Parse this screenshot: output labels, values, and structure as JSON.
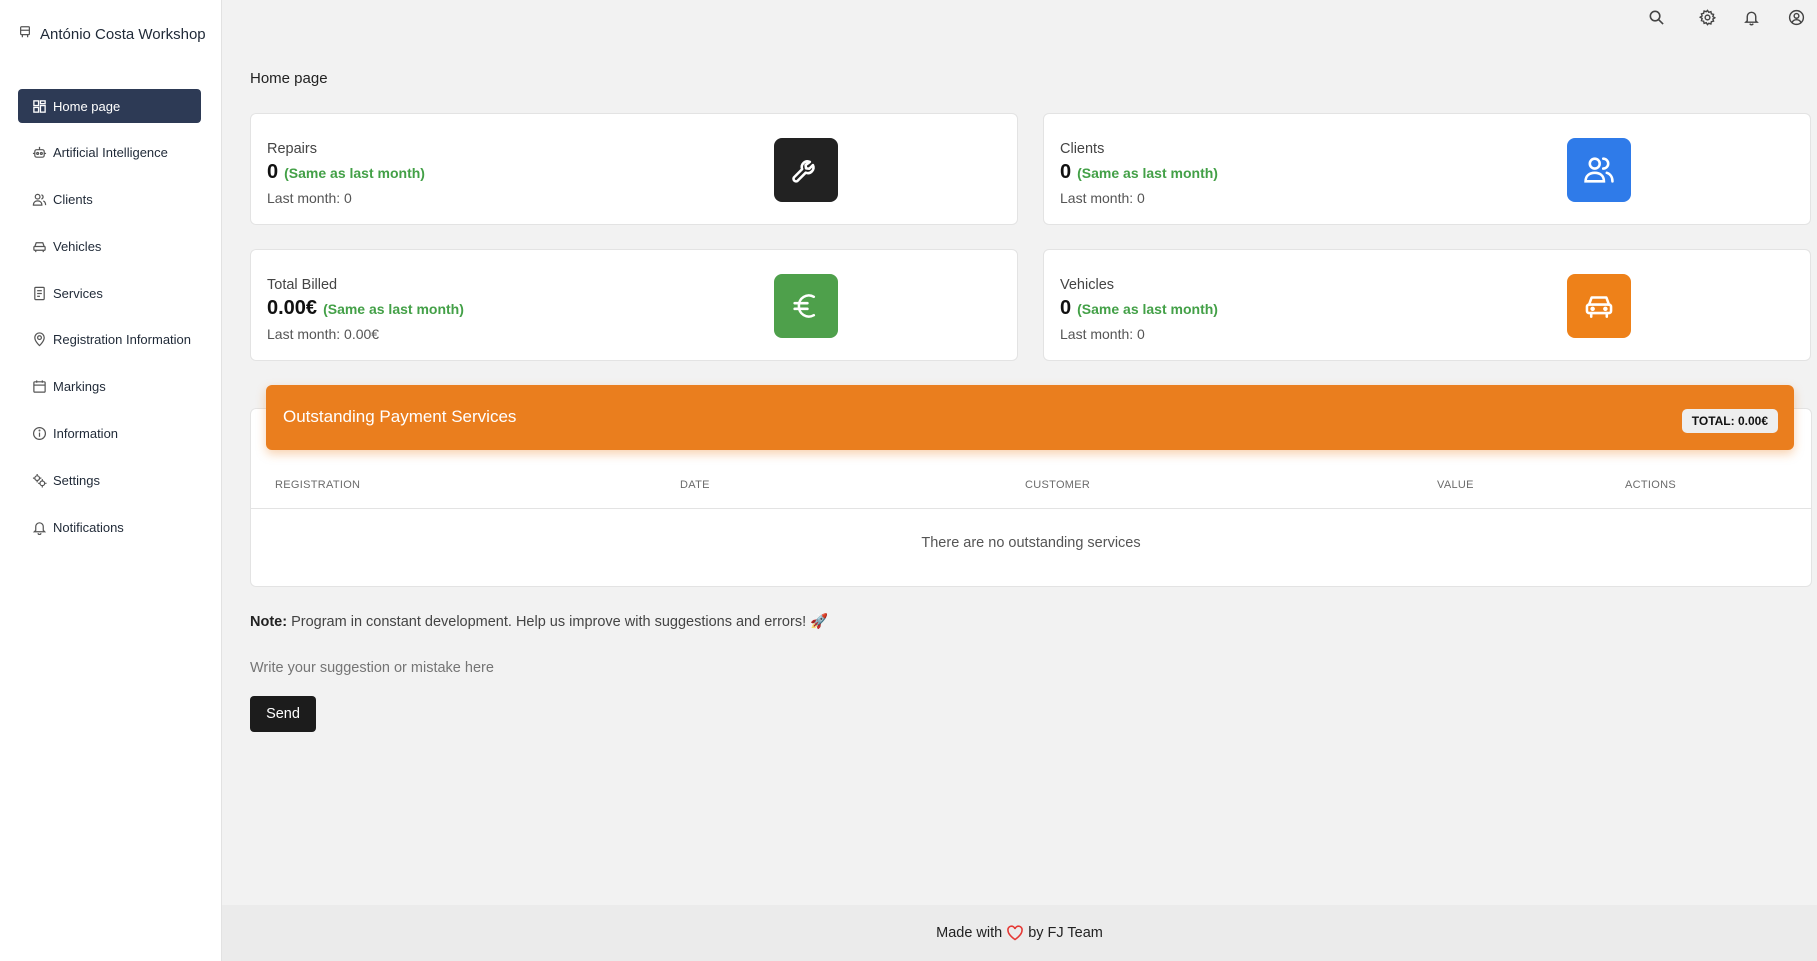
{
  "app": {
    "title": "António Costa Workshop"
  },
  "sidebar": {
    "items": [
      {
        "label": "Home page",
        "icon": "dashboard-icon",
        "active": true
      },
      {
        "label": "Artificial Intelligence",
        "icon": "robot-icon"
      },
      {
        "label": "Clients",
        "icon": "users-icon"
      },
      {
        "label": "Vehicles",
        "icon": "car-icon"
      },
      {
        "label": "Services",
        "icon": "document-icon"
      },
      {
        "label": "Registration Information",
        "icon": "location-pin-icon"
      },
      {
        "label": "Markings",
        "icon": "calendar-icon"
      },
      {
        "label": "Information",
        "icon": "info-icon"
      },
      {
        "label": "Settings",
        "icon": "gears-icon"
      },
      {
        "label": "Notifications",
        "icon": "bell-icon"
      }
    ]
  },
  "topbar": {
    "icons": [
      "search-icon",
      "gear-icon",
      "bell-icon",
      "user-circle-icon"
    ]
  },
  "page": {
    "title": "Home page"
  },
  "cards": {
    "repairs": {
      "label": "Repairs",
      "value": "0",
      "delta": "(Same as last month)",
      "last": "Last month: 0",
      "color": "#222222",
      "icon": "wrench-icon"
    },
    "clients": {
      "label": "Clients",
      "value": "0",
      "delta": "(Same as last month)",
      "last": "Last month: 0",
      "color": "#2f7be9",
      "icon": "users-icon"
    },
    "billed": {
      "label": "Total Billed",
      "value": "0.00€",
      "delta": "(Same as last month)",
      "last": "Last month: 0.00€",
      "color": "#4ea04b",
      "icon": "euro-icon"
    },
    "vehicles": {
      "label": "Vehicles",
      "value": "0",
      "delta": "(Same as last month)",
      "last": "Last month: 0",
      "color": "#ee8119",
      "icon": "car-icon"
    }
  },
  "outstanding": {
    "title": "Outstanding Payment Services",
    "total": "TOTAL: 0.00€",
    "columns": [
      "REGISTRATION",
      "DATE",
      "CUSTOMER",
      "VALUE",
      "ACTIONS"
    ],
    "empty": "There are no outstanding services",
    "accent": "#ea7e1e"
  },
  "feedback": {
    "note_label": "Note:",
    "note_text": " Program in constant development. Help us improve with suggestions and errors! 🚀",
    "placeholder": "Write your suggestion or mistake here",
    "send": "Send"
  },
  "footer": {
    "prefix": "Made with",
    "suffix": "by FJ Team"
  }
}
